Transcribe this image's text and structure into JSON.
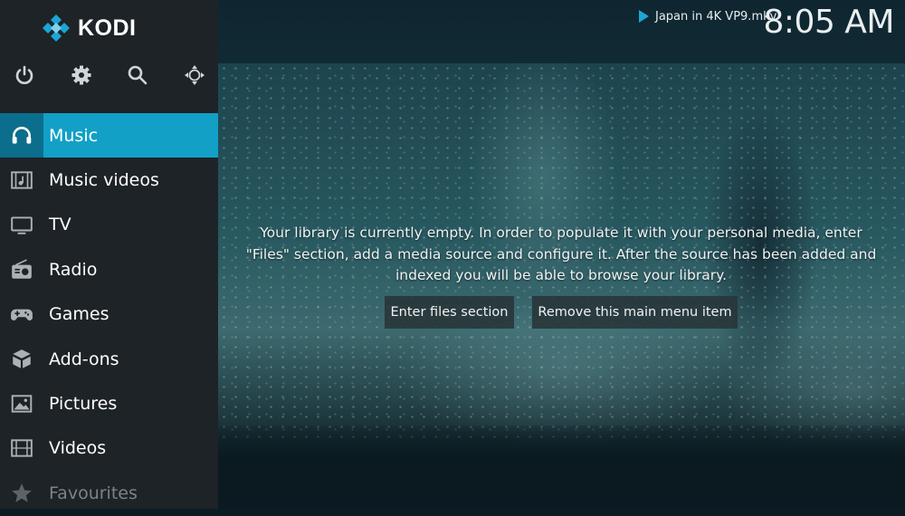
{
  "app": {
    "logo_text": "KODI"
  },
  "top_icons": [
    "power-icon",
    "gear-icon",
    "search-icon",
    "move-icon"
  ],
  "menu": [
    {
      "label": "Music",
      "icon": "headphones-icon",
      "active": true
    },
    {
      "label": "Music videos",
      "icon": "music-video-icon"
    },
    {
      "label": "TV",
      "icon": "tv-icon"
    },
    {
      "label": "Radio",
      "icon": "radio-icon"
    },
    {
      "label": "Games",
      "icon": "gamepad-icon"
    },
    {
      "label": "Add-ons",
      "icon": "addons-box-icon"
    },
    {
      "label": "Pictures",
      "icon": "pictures-icon"
    },
    {
      "label": "Videos",
      "icon": "film-icon"
    },
    {
      "label": "Favourites",
      "icon": "star-icon",
      "dim": true
    }
  ],
  "header": {
    "now_playing": "Japan in 4K VP9.mkv",
    "clock": "8:05 AM"
  },
  "main": {
    "empty_message": "Your library is currently empty. In order to populate it with your personal media, enter \"Files\" section, add a media source and configure it. After the source has been added and indexed you will be able to browse your library.",
    "buttons": {
      "enter_files": "Enter files section",
      "remove_item": "Remove this main menu item"
    }
  },
  "colors": {
    "accent": "#12a0c7",
    "accent_dark": "#0b6e8c",
    "sidebar": "#1e2327"
  }
}
